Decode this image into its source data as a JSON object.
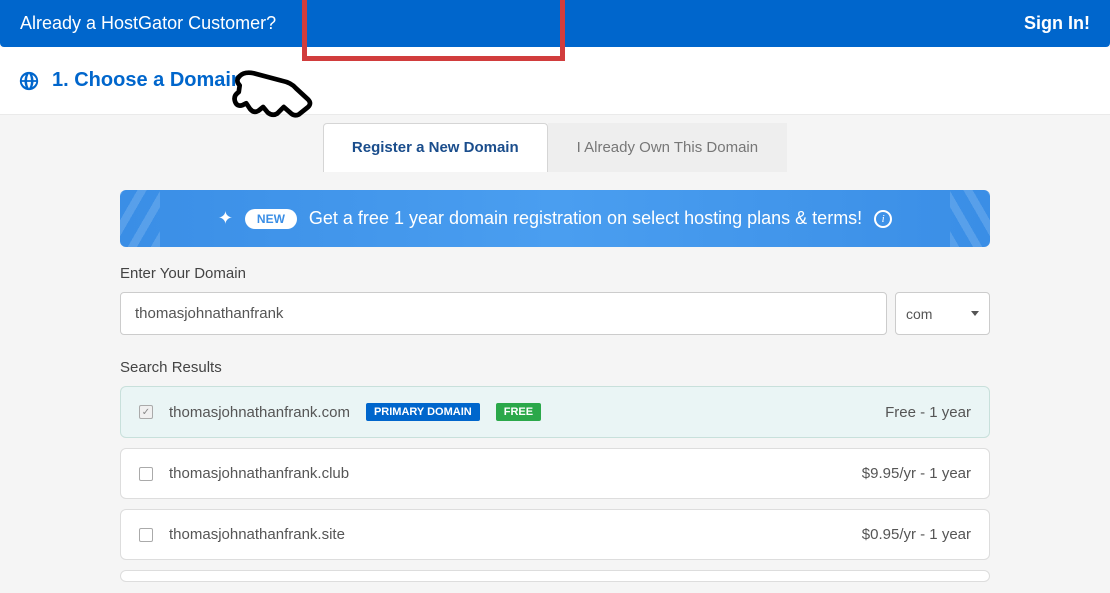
{
  "header": {
    "customer_question": "Already a HostGator Customer?",
    "sign_in": "Sign In!"
  },
  "step": {
    "title": "1. Choose a Domain"
  },
  "tabs": {
    "register": "Register a New Domain",
    "own": "I Already Own This Domain"
  },
  "promo": {
    "new_label": "NEW",
    "text": "Get a free 1 year domain registration on select hosting plans & terms!"
  },
  "form": {
    "domain_label": "Enter Your Domain",
    "domain_value": "thomasjohnathanfrank",
    "tld_value": "com"
  },
  "results": {
    "label": "Search Results",
    "items": [
      {
        "domain": "thomasjohnathanfrank.com",
        "primary_badge": "PRIMARY DOMAIN",
        "free_badge": "FREE",
        "price": "Free - 1 year",
        "checked": true
      },
      {
        "domain": "thomasjohnathanfrank.club",
        "price": "$9.95/yr - 1 year",
        "checked": false
      },
      {
        "domain": "thomasjohnathanfrank.site",
        "price": "$0.95/yr - 1 year",
        "checked": false
      }
    ]
  }
}
